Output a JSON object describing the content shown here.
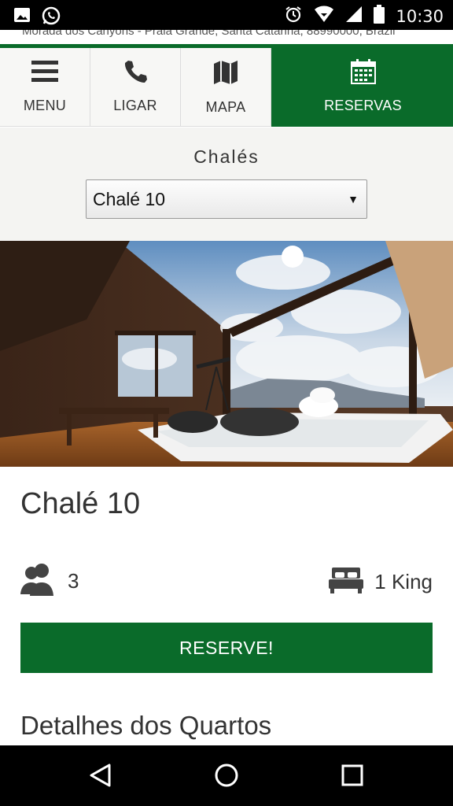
{
  "status_bar": {
    "time": "10:30",
    "left_icons": [
      "image-icon",
      "whatsapp-icon"
    ],
    "right_icons": [
      "alarm-icon",
      "wifi-icon",
      "signal-icon",
      "battery-icon"
    ]
  },
  "address": {
    "text": "Morada dos Canyons - Praia Grande, Santa Catarina, 88990000, Brazil"
  },
  "nav": {
    "items": [
      {
        "label": "MENU",
        "icon": "hamburger-icon"
      },
      {
        "label": "LIGAR",
        "icon": "phone-icon"
      },
      {
        "label": "MAPA",
        "icon": "map-icon"
      },
      {
        "label": "RESERVAS",
        "icon": "calendar-icon"
      }
    ],
    "active_color": "#0a6b2a"
  },
  "selector": {
    "title": "Chalés",
    "selected": "Chalé 10"
  },
  "room": {
    "title": "Chalé 10",
    "guests": "3",
    "beds": "1 King",
    "reserve_label": "RESERVE!",
    "details_heading": "Detalhes dos Quartos"
  },
  "colors": {
    "brand_green": "#0a6b2a",
    "text": "#333333"
  }
}
